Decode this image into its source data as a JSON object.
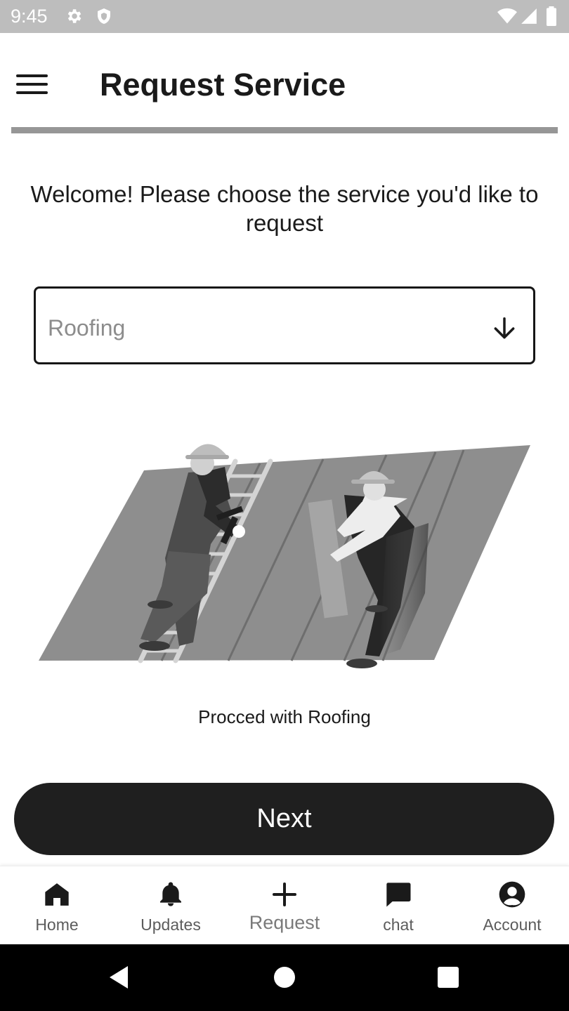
{
  "status_bar": {
    "time": "9:45",
    "icons": [
      "settings-icon",
      "shield-icon",
      "wifi-icon",
      "signal-icon",
      "battery-icon"
    ]
  },
  "app_bar": {
    "title": "Request Service",
    "menu_icon": "hamburger-menu-icon"
  },
  "main": {
    "welcome": "Welcome! Please choose the service you'd like to request",
    "service_select": {
      "selected": "Roofing",
      "icon": "arrow-down-icon"
    },
    "illustration": "roofers-illustration",
    "proceed_text": "Procced with Roofing",
    "next_label": "Next"
  },
  "bottom_nav": {
    "items": [
      {
        "label": "Home",
        "icon": "home-icon"
      },
      {
        "label": "Updates",
        "icon": "bell-icon"
      },
      {
        "label": "Request",
        "icon": "plus-icon",
        "active": true
      },
      {
        "label": "chat",
        "icon": "chat-icon"
      },
      {
        "label": "Account",
        "icon": "account-icon"
      }
    ]
  },
  "system_nav": {
    "icons": [
      "back-icon",
      "home-circle-icon",
      "recents-icon"
    ]
  },
  "colors": {
    "status_bar": "#bdbdbd",
    "primary": "#1f1f1f",
    "divider": "#969696",
    "placeholder": "#8c8c8c"
  }
}
